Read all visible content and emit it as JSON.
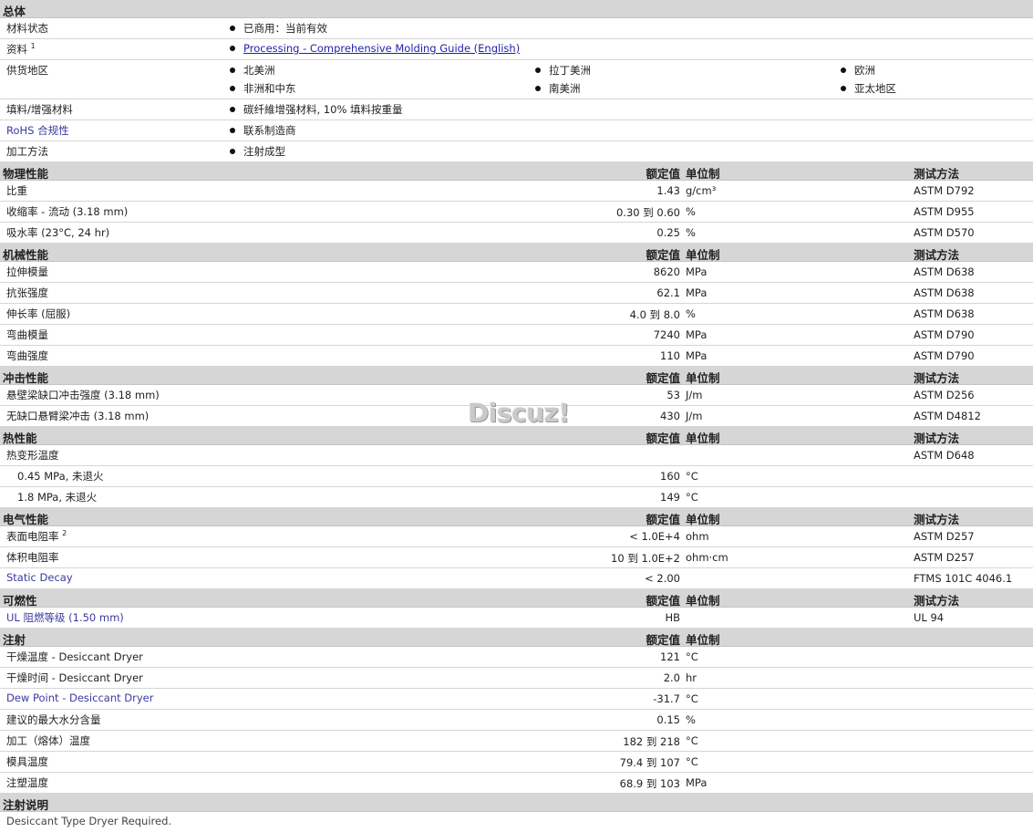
{
  "general": {
    "title": "总体",
    "rows": [
      {
        "label": "材料状态",
        "items": [
          "已商用：当前有效"
        ]
      },
      {
        "label": "资料",
        "sup": "1",
        "items": [
          "Processing - Comprehensive Molding Guide (English)"
        ]
      },
      {
        "label": "供货地区",
        "items": [
          "北美洲",
          "拉丁美洲",
          "欧洲",
          "非洲和中东",
          "南美洲",
          "亚太地区"
        ]
      },
      {
        "label": "填料/增强材料",
        "items": [
          "碳纤維增强材料, 10% 填料按重量"
        ]
      },
      {
        "label": "RoHS 合规性",
        "items": [
          "联系制造商"
        ]
      },
      {
        "label": "加工方法",
        "items": [
          "注射成型"
        ]
      }
    ]
  },
  "headers": {
    "value": "额定值",
    "unit": "单位制",
    "test": "测试方法"
  },
  "sections": [
    {
      "title": "物理性能",
      "show_test": true,
      "rows": [
        {
          "label": "比重",
          "value": "1.43",
          "unit": "g/cm³",
          "test": "ASTM D792"
        },
        {
          "label": "收缩率  - 流动  (3.18 mm)",
          "value": "0.30 到  0.60",
          "unit": "%",
          "test": "ASTM D955"
        },
        {
          "label": "吸水率  (23°C, 24 hr)",
          "value": "0.25",
          "unit": "%",
          "test": "ASTM D570"
        }
      ]
    },
    {
      "title": "机械性能",
      "show_test": true,
      "rows": [
        {
          "label": "拉伸模量",
          "value": "8620",
          "unit": "MPa",
          "test": "ASTM D638"
        },
        {
          "label": "抗张强度",
          "value": "62.1",
          "unit": "MPa",
          "test": "ASTM D638"
        },
        {
          "label": "伸长率  (屈服)",
          "value": "4.0 到  8.0",
          "unit": "%",
          "test": "ASTM D638"
        },
        {
          "label": "弯曲模量",
          "value": "7240",
          "unit": "MPa",
          "test": "ASTM D790"
        },
        {
          "label": "弯曲强度",
          "value": "110",
          "unit": "MPa",
          "test": "ASTM D790"
        }
      ]
    },
    {
      "title": "冲击性能",
      "show_test": true,
      "rows": [
        {
          "label": "悬壁梁缺口冲击强度  (3.18 mm)",
          "value": "53",
          "unit": "J/m",
          "test": "ASTM D256"
        },
        {
          "label": "无缺口悬臂梁冲击  (3.18 mm)",
          "value": "430",
          "unit": "J/m",
          "test": "ASTM D4812"
        }
      ]
    },
    {
      "title": "热性能",
      "show_test": true,
      "rows": [
        {
          "label": "热变形温度",
          "value": "",
          "unit": "",
          "test": "ASTM D648"
        },
        {
          "label": "0.45 MPa, 未退火",
          "indent": true,
          "value": "160",
          "unit": "°C",
          "test": ""
        },
        {
          "label": "1.8 MPa, 未退火",
          "indent": true,
          "value": "149",
          "unit": "°C",
          "test": ""
        }
      ]
    },
    {
      "title": "电气性能",
      "show_test": true,
      "rows": [
        {
          "label": "表面电阻率",
          "sup": "2",
          "value": "< 1.0E+4",
          "unit": "ohm",
          "test": "ASTM D257"
        },
        {
          "label": "体积电阻率",
          "value": "10 到  1.0E+2",
          "unit": "ohm·cm",
          "test": "ASTM D257"
        },
        {
          "label": "Static Decay",
          "blue": true,
          "value": "< 2.00",
          "unit": "",
          "test": "FTMS 101C 4046.1"
        }
      ]
    },
    {
      "title": "可燃性",
      "show_test": true,
      "rows": [
        {
          "label": "UL 阻燃等级  (1.50 mm)",
          "blue": true,
          "value": "HB",
          "unit": "",
          "test": "UL 94"
        }
      ]
    },
    {
      "title": "注射",
      "show_test": false,
      "rows": [
        {
          "label": "干燥温度  - Desiccant Dryer",
          "value": "121",
          "unit": "°C",
          "test": ""
        },
        {
          "label": "干燥时间  - Desiccant Dryer",
          "value": "2.0",
          "unit": "hr",
          "test": ""
        },
        {
          "label": "Dew Point - Desiccant Dryer",
          "blue": true,
          "value": "-31.7",
          "unit": "°C",
          "test": ""
        },
        {
          "label": "建议的最大水分含量",
          "value": "0.15",
          "unit": "%",
          "test": ""
        },
        {
          "label": "加工（熔体）温度",
          "value": "182 到  218",
          "unit": "°C",
          "test": ""
        },
        {
          "label": "模具温度",
          "value": "79.4 到  107",
          "unit": "°C",
          "test": ""
        },
        {
          "label": "注塑温度",
          "value": "68.9 到  103",
          "unit": "MPa",
          "test": ""
        }
      ]
    }
  ],
  "notes": {
    "title": "注射说明",
    "text": "Desiccant Type Dryer Required."
  },
  "watermark": "Discuz!"
}
